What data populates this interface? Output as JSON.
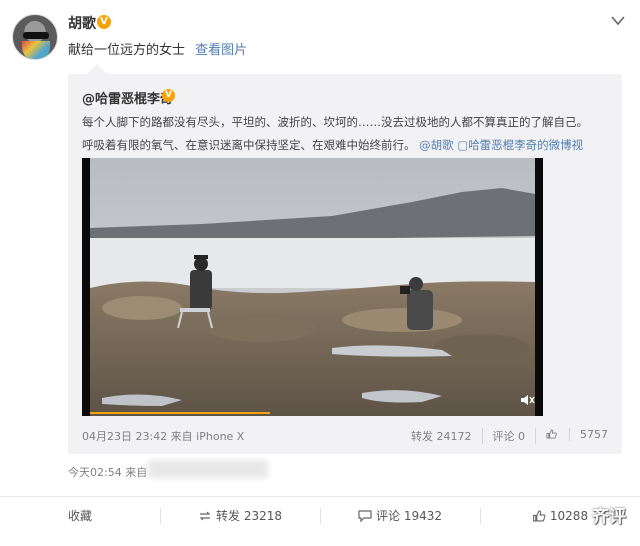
{
  "post": {
    "author": "胡歌",
    "badge": "V",
    "text": "献给一位远方的女士",
    "view_image_link": "查看图片",
    "time": "今天02:54 来自"
  },
  "repost": {
    "author": "@哈雷恶棍李奇",
    "badge": "V",
    "text": "每个人脚下的路都没有尽头，平坦的、波折的、坎坷的……没去过极地的人都不算真正的了解自己。呼吸着有限的氧气、在意识迷离中保持坚定、在艰难中始终前行。",
    "mention": "@胡歌",
    "video_link": "哈雷恶棍李奇的微博视频",
    "meta": "04月23日 23:42 来自 iPhone X",
    "repost_count": "转发 24172",
    "comment_count": "评论 0",
    "like_count": "5757"
  },
  "actions": [
    {
      "label": "收藏"
    },
    {
      "label": "转发 23218"
    },
    {
      "label": "评论 19432"
    },
    {
      "label": "10288"
    }
  ],
  "watermark": "齐评",
  "icons": {
    "more": "chevron-down-icon",
    "mute": "mute-icon",
    "like": "thumbs-up-icon"
  },
  "colors": {
    "link": "#507daf",
    "badge": "#f7a20a",
    "repost_bg": "#f2f2f5"
  }
}
